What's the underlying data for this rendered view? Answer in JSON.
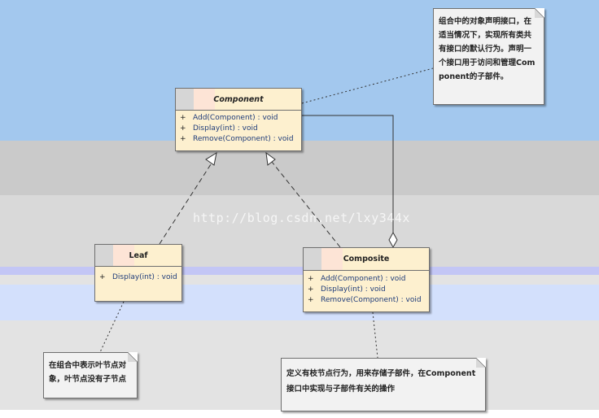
{
  "classes": {
    "component": {
      "name": "Component",
      "operations": [
        {
          "visibility": "+",
          "signature": "Add(Component) : void"
        },
        {
          "visibility": "+",
          "signature": "Display(int) : void"
        },
        {
          "visibility": "+",
          "signature": "Remove(Component) : void"
        }
      ]
    },
    "leaf": {
      "name": "Leaf",
      "operations": [
        {
          "visibility": "+",
          "signature": "Display(int) : void"
        }
      ]
    },
    "composite": {
      "name": "Composite",
      "operations": [
        {
          "visibility": "+",
          "signature": "Add(Component) : void"
        },
        {
          "visibility": "+",
          "signature": "Display(int) : void"
        },
        {
          "visibility": "+",
          "signature": "Remove(Component) : void"
        }
      ]
    }
  },
  "notes": {
    "component_note": "组合中的对象声明接口，在适当情况下，实现所有类共有接口的默认行为。声明一个接口用于访问和管理Component的子部件。",
    "leaf_note": "在组合中表示叶节点对象，叶节点没有子节点",
    "composite_note": "定义有枝节点行为，用来存储子部件，在Component接口中实现与子部件有关的操作"
  },
  "watermark": "http://blog.csdn.net/lxy344x",
  "colors": {
    "class_fill": "#fdf0cf",
    "note_fill": "#f2f2f2",
    "operation_text": "#1f3c7a"
  }
}
